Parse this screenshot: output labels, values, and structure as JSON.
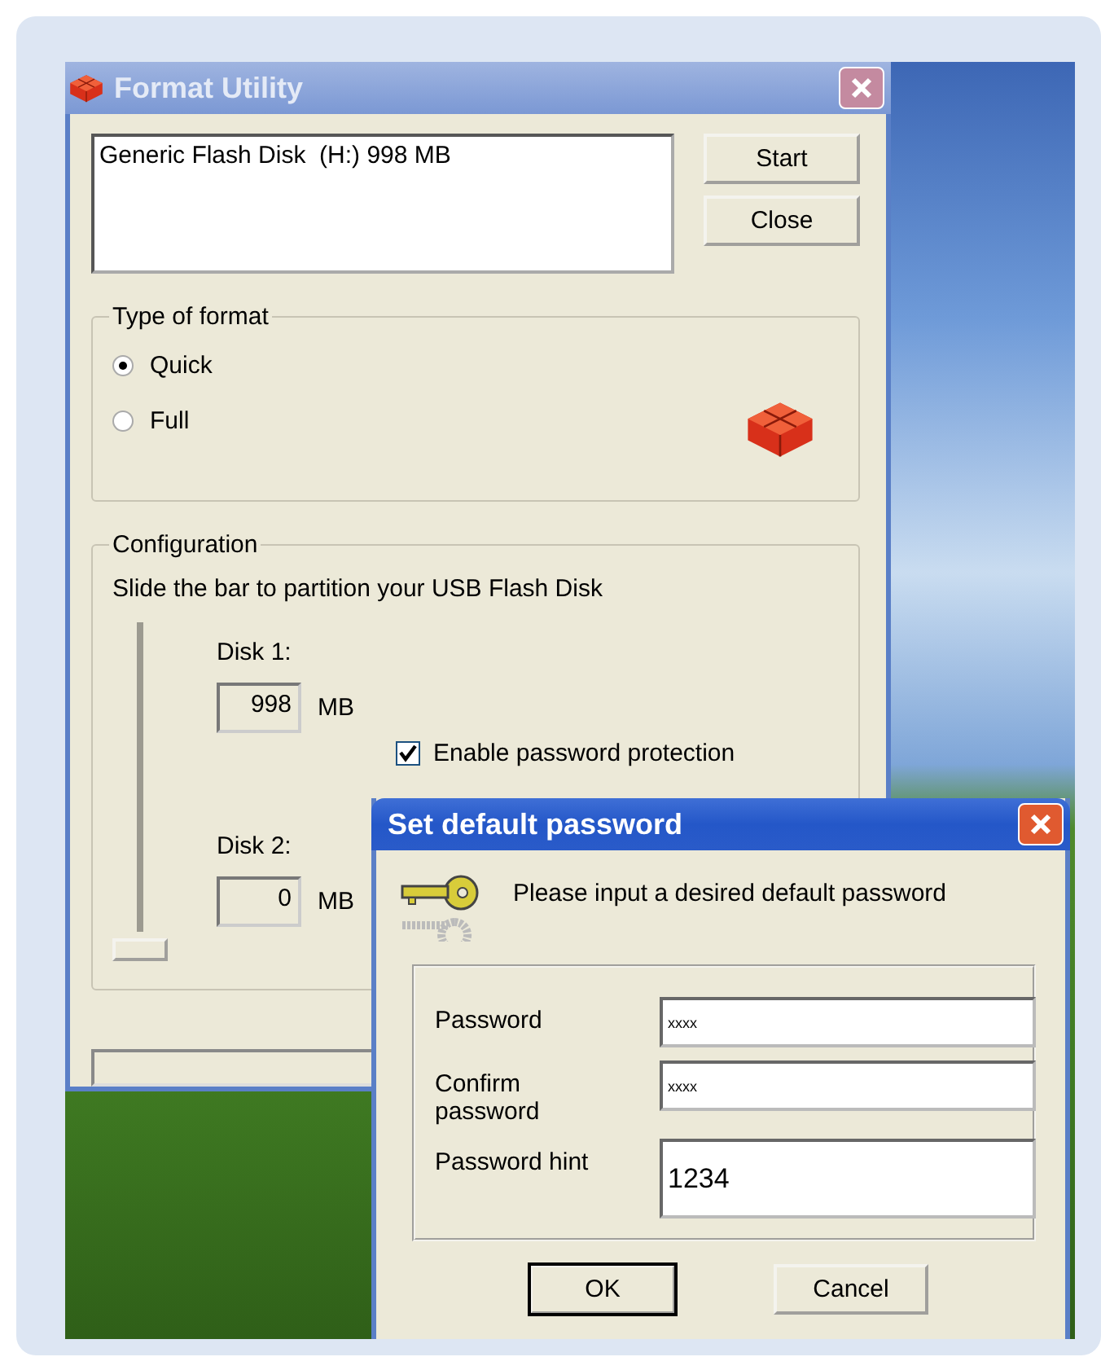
{
  "main_window": {
    "title": "Format Utility",
    "devices": [
      "Generic Flash Disk  (H:) 998 MB"
    ],
    "buttons": [
      "Start",
      "Close"
    ],
    "format_group": {
      "title": "Type of format",
      "options": [
        {
          "label": "Quick",
          "selected": true
        },
        {
          "label": "Full",
          "selected": false
        }
      ]
    },
    "configuration": {
      "title": "Configuration",
      "instruction": "Slide the bar to partition your USB Flash Disk",
      "slider": {
        "level": 1
      },
      "disks": [
        {
          "label": "Disk 1:",
          "size": "998",
          "unit": "MB"
        },
        {
          "label": "Disk 2:",
          "size": "0",
          "unit": "MB"
        }
      ],
      "password_protection": {
        "label": "Enable password protection",
        "checked": true
      }
    },
    "progress": {
      "level": 0
    }
  },
  "dialog": {
    "title": "Set default password",
    "message": "Please input a desired default password",
    "fields": [
      {
        "kind": "line",
        "label": "Password",
        "value": "xxxx"
      },
      {
        "kind": "line",
        "label": "Confirm password",
        "value": "xxxx"
      },
      {
        "kind": "area",
        "label": "Password hint",
        "value": "1234"
      }
    ],
    "buttons": [
      {
        "label": "OK",
        "default": true
      },
      {
        "label": "Cancel",
        "default": false
      }
    ]
  }
}
